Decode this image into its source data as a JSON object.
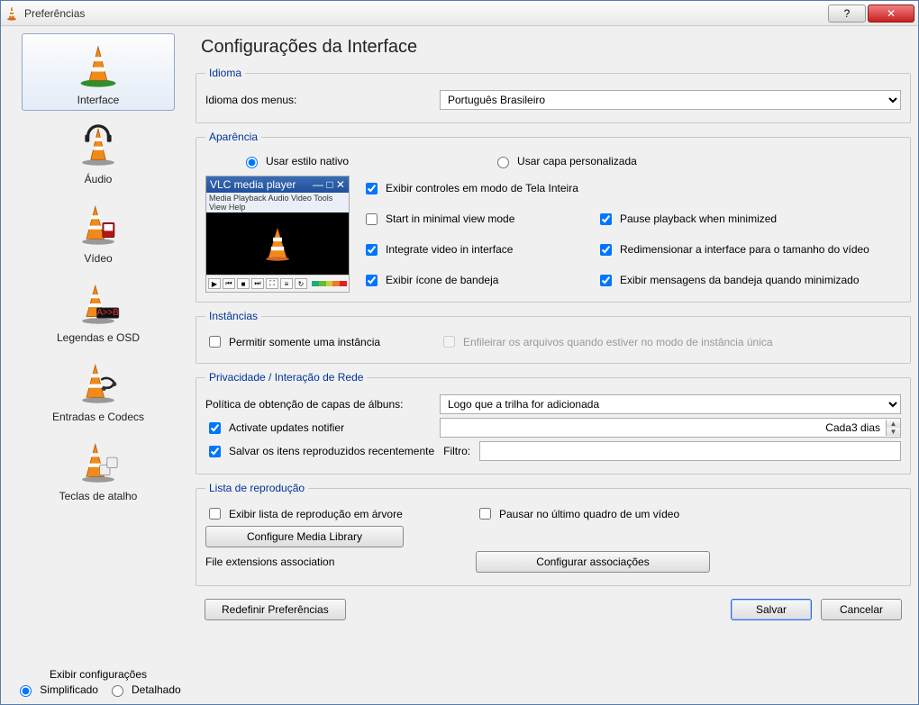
{
  "window": {
    "title": "Preferências"
  },
  "titlebar_buttons": {
    "help": "?",
    "close": "✕"
  },
  "sidebar": {
    "items": [
      {
        "label": "Interface"
      },
      {
        "label": "Áudio"
      },
      {
        "label": "Vídeo"
      },
      {
        "label": "Legendas e OSD"
      },
      {
        "label": "Entradas e Codecs"
      },
      {
        "label": "Teclas de atalho"
      }
    ]
  },
  "show_settings": {
    "title": "Exibir configurações",
    "simple": "Simplificado",
    "detailed": "Detalhado"
  },
  "page": {
    "title": "Configurações da Interface"
  },
  "language": {
    "legend": "Idioma",
    "label": "Idioma dos menus:",
    "value": "Português Brasileiro"
  },
  "appearance": {
    "legend": "Aparência",
    "native": "Usar estilo nativo",
    "custom": "Usar capa personalizada",
    "preview_title": "VLC media player",
    "preview_menu": "Media  Playback  Audio  Video  Tools  View  Help",
    "chk_fullscreen": "Exibir controles em modo de Tela Inteira",
    "chk_minimal": "Start in minimal view mode",
    "chk_pause_min": "Pause playback when minimized",
    "chk_integrate": "Integrate video in interface",
    "chk_resize": "Redimensionar a interface para o tamanho do vídeo",
    "chk_tray": "Exibir ícone de bandeja",
    "chk_tray_msg": "Exibir mensagens da bandeja quando minimizado"
  },
  "instances": {
    "legend": "Instâncias",
    "only_one": "Permitir somente uma instância",
    "enqueue": "Enfileirar os arquivos quando estiver no modo de instância única"
  },
  "privacy": {
    "legend": "Privacidade / Interação de Rede",
    "album_label": "Política de obtenção de capas de álbuns:",
    "album_value": "Logo que a trilha for adicionada",
    "updates": "Activate updates notifier",
    "updates_interval": "Cada3 dias",
    "save_recent": "Salvar os itens reproduzidos recentemente",
    "filter_label": "Filtro:"
  },
  "playlist": {
    "legend": "Lista de reprodução",
    "tree": "Exibir lista de reprodução em árvore",
    "pause_last": "Pausar no último quadro de um vídeo",
    "config_lib": "Configure Media Library",
    "assoc_label": "File extensions association",
    "assoc_btn": "Configurar associações"
  },
  "footer": {
    "reset": "Redefinir Preferências",
    "save": "Salvar",
    "cancel": "Cancelar"
  }
}
